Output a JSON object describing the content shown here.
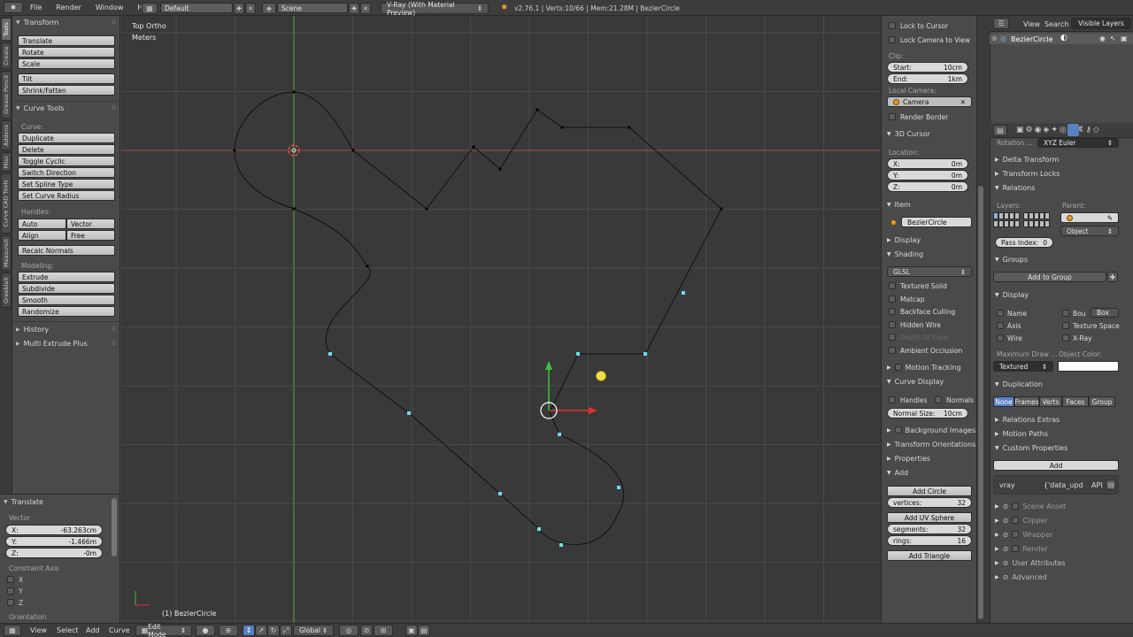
{
  "topbar": {
    "menus": [
      "File",
      "Render",
      "Window",
      "Help"
    ],
    "layout": "Default",
    "scene": "Scene",
    "engine": "V-Ray (With Material Preview)",
    "stats": "v2.76.1 | Verts:10/66 | Mem:21.28M | BezierCircle"
  },
  "vtabs": [
    "Tools",
    "Create",
    "Grease Pencil",
    "Addons",
    "Misc",
    "Curve CAD Tools",
    "Measureit",
    "GreebleX"
  ],
  "tools": {
    "transform": {
      "title": "Transform",
      "buttons": [
        "Translate",
        "Rotate",
        "Scale",
        "Tilt",
        "Shrink/Fatten"
      ]
    },
    "curve_tools": {
      "title": "Curve Tools",
      "curve_label": "Curve:",
      "buttons": [
        "Duplicate",
        "Delete",
        "Toggle Cyclic",
        "Switch Direction",
        "Set Spline Type",
        "Set Curve Radius"
      ],
      "handles_label": "Handles:",
      "handles": [
        "Auto",
        "Vector",
        "Align",
        "Free"
      ],
      "recalc": "Recalc Normals",
      "modeling_label": "Modeling:",
      "modeling": [
        "Extrude",
        "Subdivide",
        "Smooth",
        "Randomize"
      ]
    },
    "history": "History",
    "multi_extrude": "Multi Extrude Plus"
  },
  "operator": {
    "title": "Translate",
    "vector_label": "Vector",
    "x_label": "X:",
    "x": "-63.263cm",
    "y_label": "Y:",
    "y": "-1.466m",
    "z_label": "Z:",
    "z": "-0m",
    "constraint_label": "Constraint Axis",
    "axes": [
      "X",
      "Y",
      "Z"
    ],
    "orientation_label": "Orientation"
  },
  "viewport": {
    "view_name": "Top Ortho",
    "units": "Meters",
    "object_label": "(1) BezierCircle"
  },
  "npanel": {
    "lock_to_cursor": "Lock to Cursor",
    "lock_camera": "Lock Camera to View",
    "clip_label": "Clip:",
    "start_label": "Start:",
    "start": "10cm",
    "end_label": "End:",
    "end": "1km",
    "local_camera_label": "Local Camera:",
    "camera": "Camera",
    "render_border": "Render Border",
    "cursor_title": "3D Cursor",
    "location_label": "Location:",
    "cx_label": "X:",
    "cx": "0m",
    "cy_label": "Y:",
    "cy": "0m",
    "cz_label": "Z:",
    "cz": "0m",
    "item_title": "Item",
    "item_name": "BezierCircle",
    "display_title": "Display",
    "shading_title": "Shading",
    "shading_mode": "GLSL",
    "shading_opts": [
      "Textured Solid",
      "Matcap",
      "Backface Culling",
      "Hidden Wire",
      "Depth Of Field",
      "Ambient Occlusion"
    ],
    "motion_tracking": "Motion Tracking",
    "curve_display": "Curve Display",
    "handles": "Handles",
    "normals": "Normals",
    "normal_size_label": "Normal Size:",
    "normal_size": "10cm",
    "background_images": "Background Images",
    "transform_orientations": "Transform Orientations",
    "properties": "Properties",
    "add": "Add",
    "add_circle": "Add Circle",
    "vertices_label": "vertices:",
    "vertices": "32",
    "add_uv_sphere": "Add UV Sphere",
    "segments_label": "segments:",
    "segments": "32",
    "rings_label": "rings:",
    "rings": "16",
    "add_triangle": "Add Triangle"
  },
  "outliner": {
    "tabs": [
      "View",
      "Search",
      "Visible Layers"
    ],
    "item": "BezierCircle"
  },
  "props": {
    "rotation_label": "Rotation ...",
    "rotation_mode": "XYZ Euler",
    "delta_transform": "Delta Transform",
    "transform_locks": "Transform Locks",
    "relations": "Relations",
    "layers_label": "Layers:",
    "parent_label": "Parent:",
    "parent_type": "Object",
    "pass_index_label": "Pass Index:",
    "pass_index": "0",
    "groups": "Groups",
    "add_to_group": "Add to Group",
    "display": "Display",
    "name": "Name",
    "bou": "Bou",
    "box": "Box",
    "axis": "Axis",
    "texture_space": "Texture Space",
    "wire": "Wire",
    "xray": "X-Ray",
    "max_draw_label": "Maximum Draw ...",
    "object_color_label": "Object Color:",
    "max_draw": "Textured",
    "duplication": "Duplication",
    "dup_modes": [
      "None",
      "Frames",
      "Verts",
      "Faces",
      "Group"
    ],
    "relations_extras": "Relations Extras",
    "motion_paths": "Motion Paths",
    "custom_properties": "Custom Properties",
    "add": "Add",
    "vray_key": "vray",
    "vray_val": "{'data_upd",
    "api": "API",
    "subs": [
      "Scene Asset",
      "Clipper",
      "Wrapper",
      "Render",
      "User Attributes",
      "Advanced"
    ]
  },
  "bottombar": {
    "menus": [
      "View",
      "Select",
      "Add",
      "Curve"
    ],
    "mode": "Edit Mode",
    "orientation": "Global"
  },
  "colors": {
    "accent": "#5680c2",
    "x_axis": "#d04040",
    "y_axis": "#66b040",
    "cursor": "#ff5050"
  }
}
